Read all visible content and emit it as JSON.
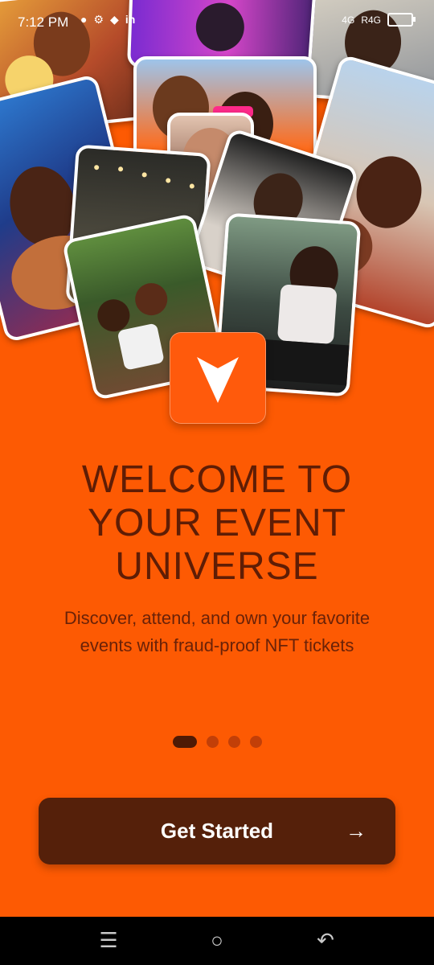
{
  "status_bar": {
    "time": "7:12 PM",
    "left_icons": [
      "person-icon",
      "settings-icon",
      "binance-icon",
      "linkedin-icon",
      "person-icon"
    ],
    "network": "4G",
    "signal": "R4G"
  },
  "hero": {
    "photos": [
      "crowd-party-photo",
      "friends-selfie-photo",
      "concert-photo",
      "festival-crowd-photo",
      "dj-booth-photo",
      "laughing-friends-photo"
    ]
  },
  "logo": {
    "icon": "arrow-down-logo"
  },
  "welcome": {
    "title_line1": "WELCOME TO",
    "title_line2": "YOUR EVENT",
    "title_line3": "UNIVERSE",
    "subtitle": "Discover, attend, and own your favorite events with fraud-proof NFT tickets"
  },
  "pagination": {
    "current": 1,
    "total": 4
  },
  "cta": {
    "label": "Get Started",
    "icon": "arrow-right-icon"
  },
  "nav_bar": {
    "buttons": [
      "menu-icon",
      "home-icon",
      "back-icon"
    ]
  },
  "colors": {
    "background": "#fd5a03",
    "title": "#5f1d05",
    "button": "#55200a",
    "button_text": "#ffffff"
  }
}
